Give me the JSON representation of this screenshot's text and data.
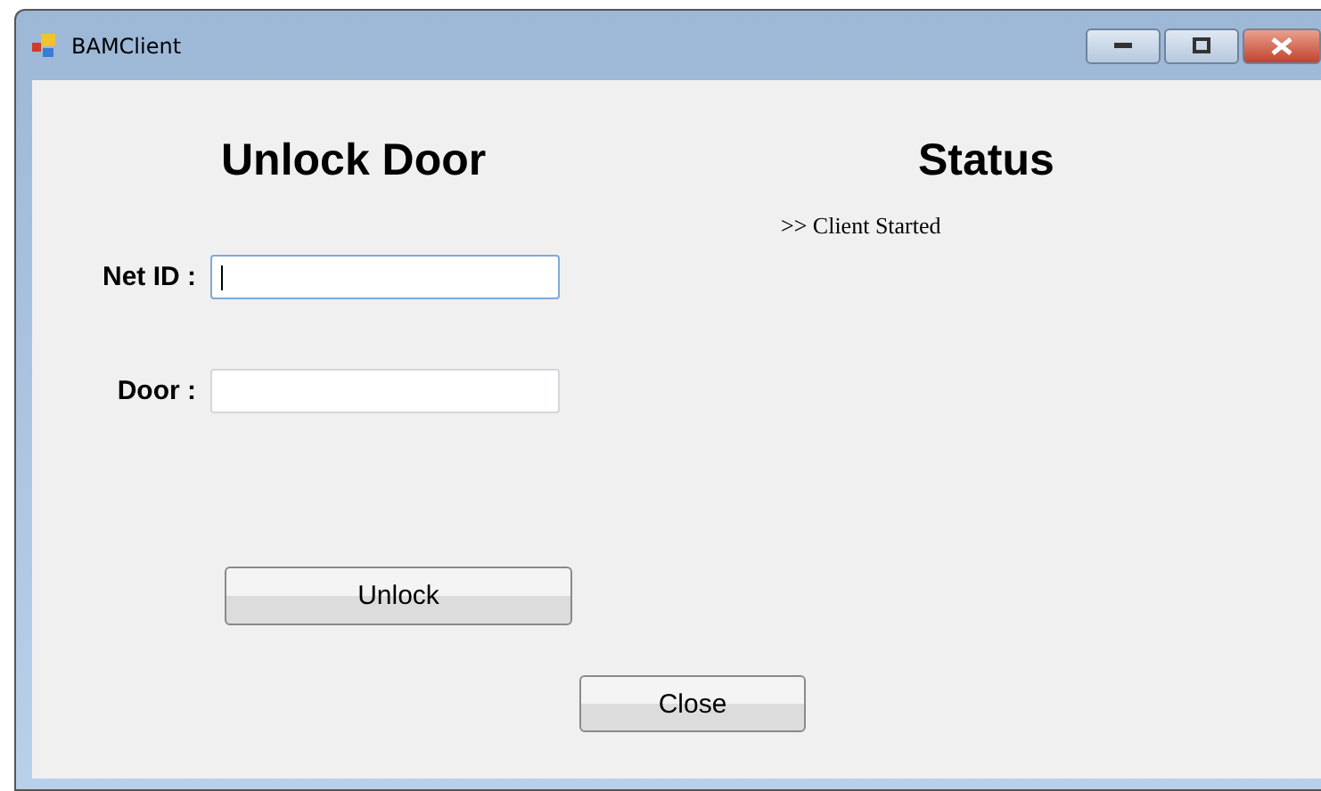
{
  "window": {
    "title": "BAMClient"
  },
  "unlock_panel": {
    "heading": "Unlock Door",
    "fields": [
      {
        "label": "Net ID :",
        "focused": true
      },
      {
        "label": "Door :",
        "focused": false
      }
    ],
    "button": "Unlock"
  },
  "status_panel": {
    "heading": "Status",
    "lines": [
      ">> Client Started"
    ]
  },
  "close_button": "Close"
}
